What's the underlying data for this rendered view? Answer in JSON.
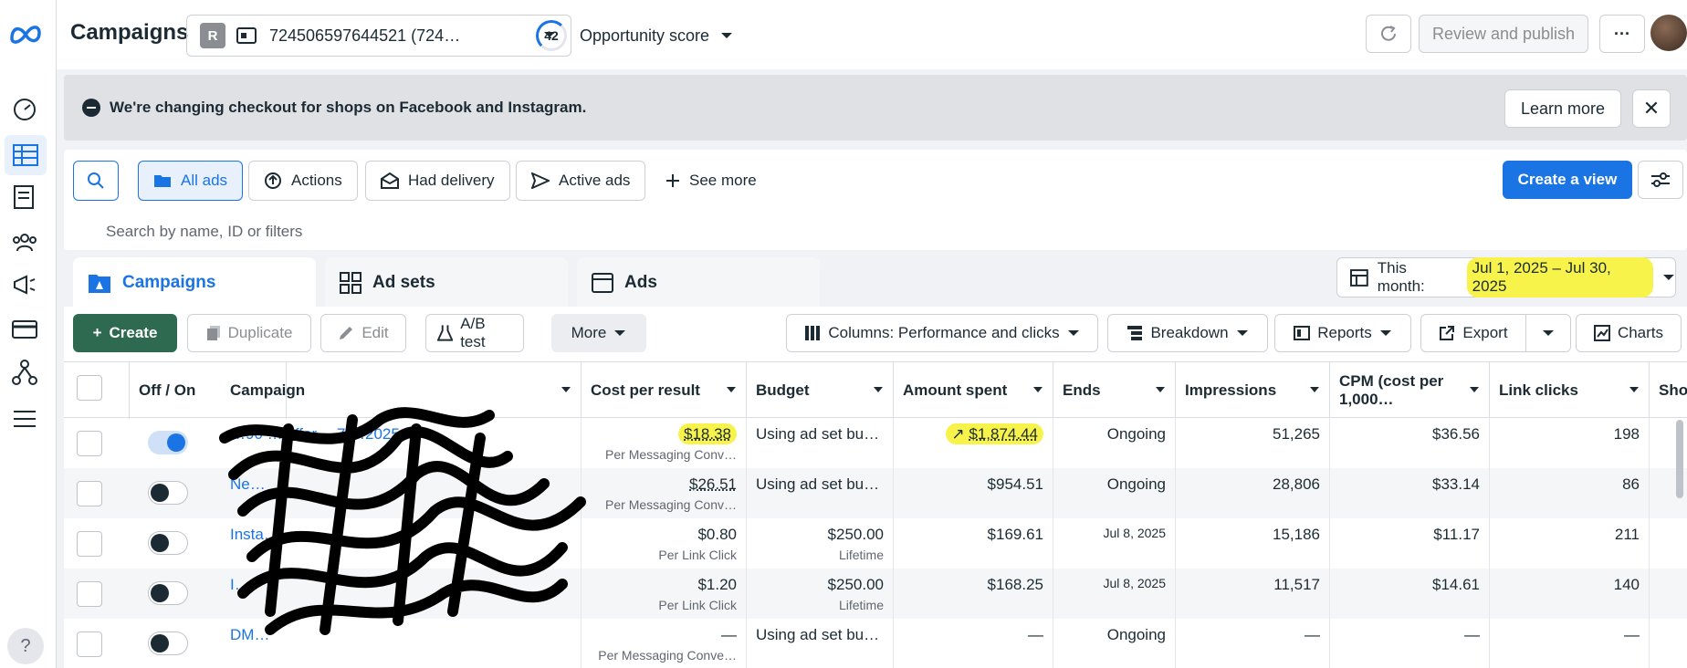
{
  "rail": {
    "icons": [
      "meta-logo-icon",
      "dashboard-icon",
      "ads-manager-table-icon",
      "pages-icon",
      "audience-icon",
      "megaphone-icon",
      "billing-card-icon",
      "events-icon",
      "menu-icon"
    ],
    "help_label": "?"
  },
  "header": {
    "title": "Campaigns",
    "account_badge": "R",
    "account_name": "724506597644521 (724…",
    "opportunity_score": "42",
    "opportunity_label": "Opportunity score",
    "review_publish": "Review and publish",
    "more": "···"
  },
  "banner": {
    "message": "We're changing checkout for shops on Facebook and Instagram.",
    "learn_more": "Learn more",
    "close": "✕"
  },
  "filters": {
    "chips": [
      "All ads",
      "Actions",
      "Had delivery",
      "Active ads",
      "See more"
    ],
    "create_view": "Create a view",
    "search_placeholder": "Search by name, ID or filters"
  },
  "tabs": [
    "Campaigns",
    "Ad sets",
    "Ads"
  ],
  "date": {
    "label": "This month:",
    "range": "Jul 1, 2025 – Jul 30, 2025"
  },
  "toolbar": {
    "create": "Create",
    "duplicate": "Duplicate",
    "edit": "Edit",
    "ab_test": "A/B test",
    "more": "More",
    "columns": "Columns: Performance and clicks",
    "breakdown": "Breakdown",
    "reports": "Reports",
    "export": "Export",
    "charts": "Charts"
  },
  "table": {
    "columns": [
      "Off / On",
      "Campaign",
      "Cost per result",
      "Budget",
      "Amount spent",
      "Ends",
      "Impressions",
      "CPM (cost per 1,000…",
      "Link clicks",
      "Sho"
    ],
    "rows": [
      {
        "on": true,
        "campaign": "…90 …Offer… 7/…2025",
        "cost": "$18.38",
        "cost_sub": "Per Messaging Conv…",
        "budget": "Using ad set bu…",
        "budget_sub": "",
        "spent": "$1,874.44",
        "ends": "Ongoing",
        "impressions": "51,265",
        "cpm": "$36.56",
        "clicks": "198"
      },
      {
        "on": false,
        "campaign": "Ne…",
        "cost": "$26.51",
        "cost_sub": "Per Messaging Conv…",
        "budget": "Using ad set bu…",
        "budget_sub": "",
        "spent": "$954.51",
        "ends": "Ongoing",
        "impressions": "28,806",
        "cpm": "$33.14",
        "clicks": "86"
      },
      {
        "on": false,
        "campaign": "Insta…",
        "cost": "$0.80",
        "cost_sub": "Per Link Click",
        "budget": "$250.00",
        "budget_sub": "Lifetime",
        "spent": "$169.61",
        "ends": "Jul 8, 2025",
        "impressions": "15,186",
        "cpm": "$11.17",
        "clicks": "211"
      },
      {
        "on": false,
        "campaign": "I…",
        "cost": "$1.20",
        "cost_sub": "Per Link Click",
        "budget": "$250.00",
        "budget_sub": "Lifetime",
        "spent": "$168.25",
        "ends": "Jul 8, 2025",
        "impressions": "11,517",
        "cpm": "$14.61",
        "clicks": "140"
      },
      {
        "on": false,
        "campaign": "DM…",
        "cost": "—",
        "cost_sub": "Per Messaging Conve…",
        "budget": "Using ad set bu…",
        "budget_sub": "",
        "spent": "—",
        "ends": "Ongoing",
        "impressions": "—",
        "cpm": "—",
        "clicks": "—"
      }
    ]
  },
  "colors": {
    "accent": "#1b74e4",
    "create_green": "#2d6a4f",
    "highlight": "#f7f34a"
  }
}
